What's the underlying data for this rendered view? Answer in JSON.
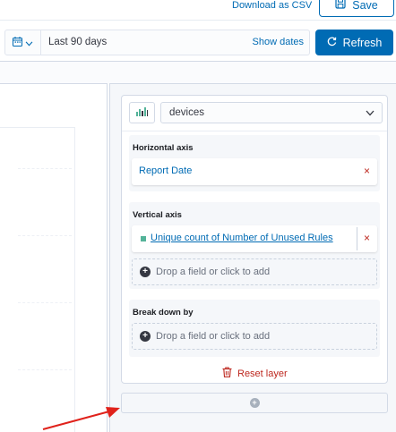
{
  "header": {
    "download_csv_label": "Download as CSV",
    "save_label": "Save"
  },
  "querybar": {
    "date_range_label": "Last 90 days",
    "show_dates_label": "Show dates",
    "refresh_label": "Refresh"
  },
  "config": {
    "layer_select_value": "devices",
    "horizontal_axis": {
      "title": "Horizontal axis",
      "field": "Report Date",
      "remove_glyph": "×"
    },
    "vertical_axis": {
      "title": "Vertical axis",
      "field": "Unique count of Number of Unused Rules",
      "remove_glyph": "×",
      "drop_placeholder": "Drop a field or click to add"
    },
    "break_down_by": {
      "title": "Break down by",
      "drop_placeholder": "Drop a field or click to add"
    },
    "reset_layer_label": "Reset layer"
  },
  "colors": {
    "primary": "#006bb4",
    "danger": "#bd271e",
    "series": "#54b399",
    "annotation_arrow": "#e0221b"
  },
  "icons": [
    "save-icon",
    "calendar-icon",
    "chevron-down-icon",
    "refresh-icon",
    "bar-chart-icon",
    "plus-circle-icon",
    "trash-icon",
    "arrow-annotation"
  ]
}
